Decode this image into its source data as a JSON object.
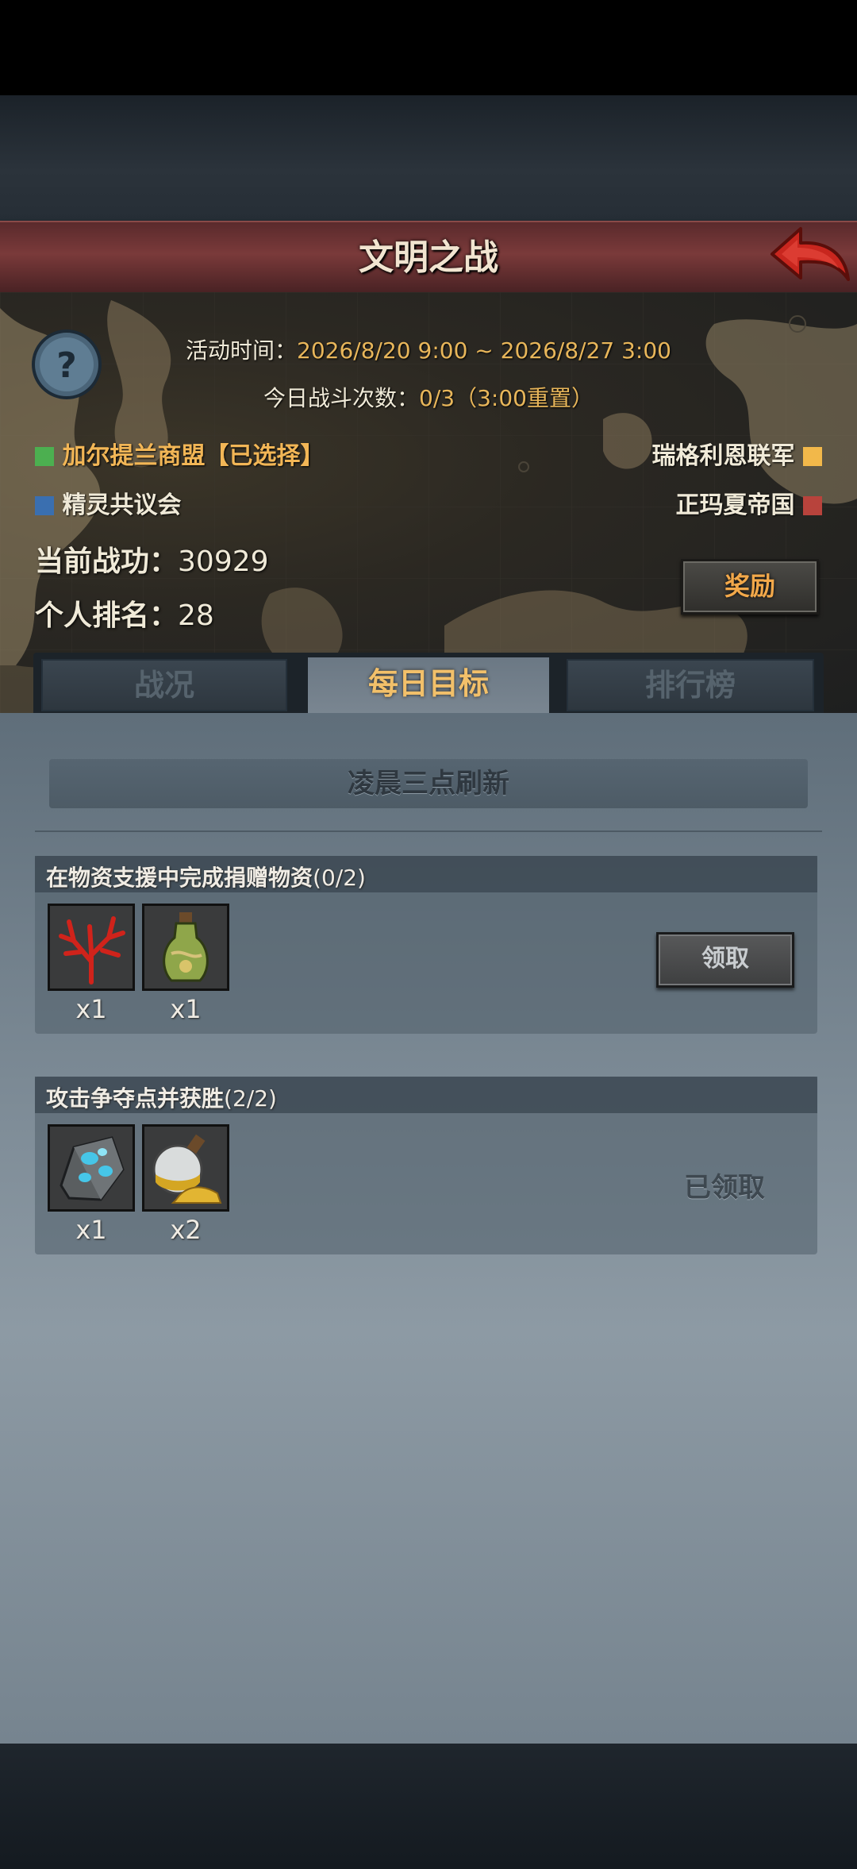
{
  "header": {
    "title": "文明之战"
  },
  "event": {
    "time_label": "活动时间：",
    "time_value": "2026/8/20 9:00 ~ 2026/8/27 3:00",
    "battle_label": "今日战斗次数：",
    "battle_value": "0/3（3:00重置）"
  },
  "factions": [
    {
      "label": "加尔提兰商盟【已选择】",
      "color": "#4caf50"
    },
    {
      "label": "精灵共议会",
      "color": "#3a6fb0"
    },
    {
      "label": "瑞格利恩联军",
      "color": "#f2b84a"
    },
    {
      "label": "正玛夏帝国",
      "color": "#b8433c"
    }
  ],
  "stats": {
    "merit_label": "当前战功：",
    "merit_value": "30929",
    "rank_label": "个人排名：",
    "rank_value": "28"
  },
  "reward_button": "奖励",
  "tabs": [
    {
      "label": "战况"
    },
    {
      "label": "每日目标"
    },
    {
      "label": "排行榜"
    }
  ],
  "refresh_note": "凌晨三点刷新",
  "tasks": [
    {
      "title": "在物资支援中完成捐赠物资",
      "progress": "(0/2)",
      "rewards": [
        {
          "icon": "red-coral-icon",
          "qty": "x1"
        },
        {
          "icon": "potion-bottle-icon",
          "qty": "x1"
        }
      ],
      "action": "领取"
    },
    {
      "title": "攻击争夺点并获胜",
      "progress": "(2/2)",
      "rewards": [
        {
          "icon": "blue-crystal-ore-icon",
          "qty": "x1"
        },
        {
          "icon": "gold-dust-flask-icon",
          "qty": "x2"
        }
      ],
      "status": "已领取"
    }
  ]
}
